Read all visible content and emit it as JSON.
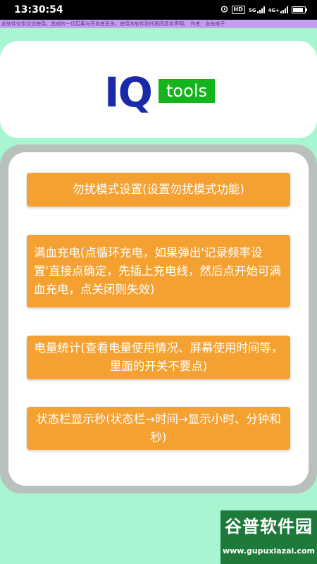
{
  "status_bar": {
    "time": "13:30:54",
    "indicators": [
      "HD",
      "5G",
      "4G+"
    ],
    "icons": [
      "alarm-icon",
      "hd-icon",
      "signal-5g-icon",
      "signal-4g-icon",
      "battery-icon"
    ]
  },
  "disclaimer": "此软件仅供交流使用。造成的一切后果与开发者无关。使用本软件则代表同意本声明。 作者：自由电子",
  "logo": {
    "primary": "IQ",
    "secondary": "tools",
    "colors": {
      "primary": "#1a2aa8",
      "secondary_bg": "#16b41c"
    }
  },
  "actions": [
    {
      "label": "勿扰模式设置(设置勿扰模式功能)"
    },
    {
      "label": "满血充电(点循环充电，如果弹出'记录频率设置'直接点确定，先插上充电线，然后点开始可满血充电，点关闭则失效)"
    },
    {
      "label": "电量统计(查看电量使用情况、屏幕使用时间等，里面的开关不要点)"
    },
    {
      "label": "状态栏显示秒(状态栏→时间→显示小时、分钟和秒)"
    }
  ],
  "watermark": {
    "title": "谷普软件园",
    "url": "www.gupuxiazai.com"
  },
  "colors": {
    "background": "#a8f5d2",
    "button": "#f5a132",
    "panel_border": "#b9c1bd"
  }
}
